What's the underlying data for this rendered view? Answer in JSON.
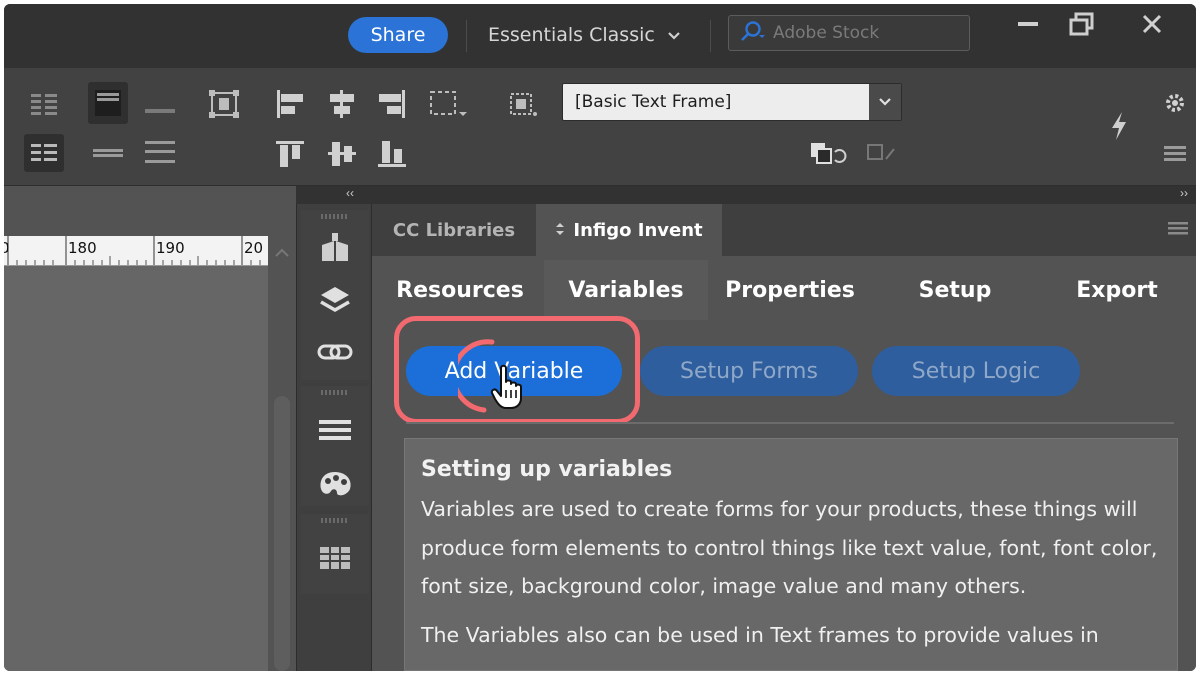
{
  "titlebar": {
    "share_label": "Share",
    "workspace_label": "Essentials Classic",
    "stock_placeholder": "Adobe Stock"
  },
  "control_bar": {
    "object_style_value": "[Basic Text Frame]"
  },
  "ruler": {
    "labels": [
      "0",
      "180",
      "190",
      "20"
    ]
  },
  "panel": {
    "tabs": [
      {
        "label": "CC Libraries"
      },
      {
        "label": "Infigo Invent"
      }
    ],
    "subtabs": [
      {
        "label": "Resources"
      },
      {
        "label": "Variables"
      },
      {
        "label": "Properties"
      },
      {
        "label": "Setup"
      },
      {
        "label": "Export"
      }
    ],
    "buttons": {
      "add_variable": "Add Variable",
      "setup_forms": "Setup Forms",
      "setup_logic": "Setup Logic"
    },
    "info": {
      "title": "Setting up variables",
      "paragraph1": "Variables are used to create forms for your products, these things will produce form elements to control things like text value, font, font color, font size, background color, image value and many others.",
      "paragraph2": "The Variables also can be used in Text frames to provide values in"
    }
  },
  "colors": {
    "accent": "#1c6fd8",
    "share": "#2b73d6",
    "highlight": "#f26a6f"
  }
}
